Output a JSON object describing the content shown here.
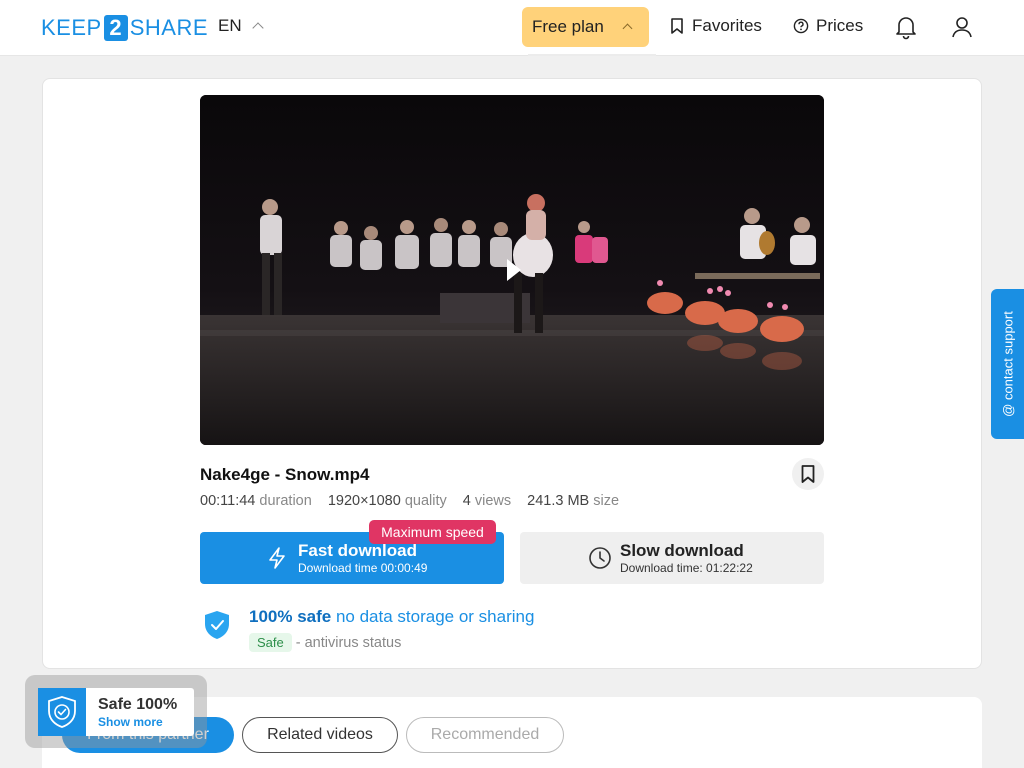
{
  "header": {
    "logo": {
      "pre": "KEEP",
      "num": "2",
      "post": "SHARE"
    },
    "language": "EN",
    "plan": "Free plan",
    "favorites": "Favorites",
    "prices": "Prices"
  },
  "file": {
    "name": "Nake4ge - Snow.mp4",
    "duration_value": "00:11:44",
    "duration_label": "duration",
    "quality_value": "1920×1080",
    "quality_label": "quality",
    "views_value": "4",
    "views_label": "views",
    "size_value": "241.3 MB",
    "size_label": "size"
  },
  "download": {
    "fast_title": "Fast download",
    "fast_time": "Download time 00:00:49",
    "max_speed": "Maximum speed",
    "slow_title": "Slow download",
    "slow_time": "Download time: 01:22:22"
  },
  "safety": {
    "headline_bold": "100% safe",
    "headline_rest": "no data storage or sharing",
    "badge": "Safe",
    "status": "- antivirus status"
  },
  "support": "@ contact support",
  "tabs": [
    "From this partner",
    "Related videos",
    "Recommended"
  ],
  "widget": {
    "title": "Safe 100%",
    "link": "Show more"
  },
  "colors": {
    "accent": "#1a8fe3",
    "plan": "#ffd27a",
    "badge_red": "#e03564"
  }
}
